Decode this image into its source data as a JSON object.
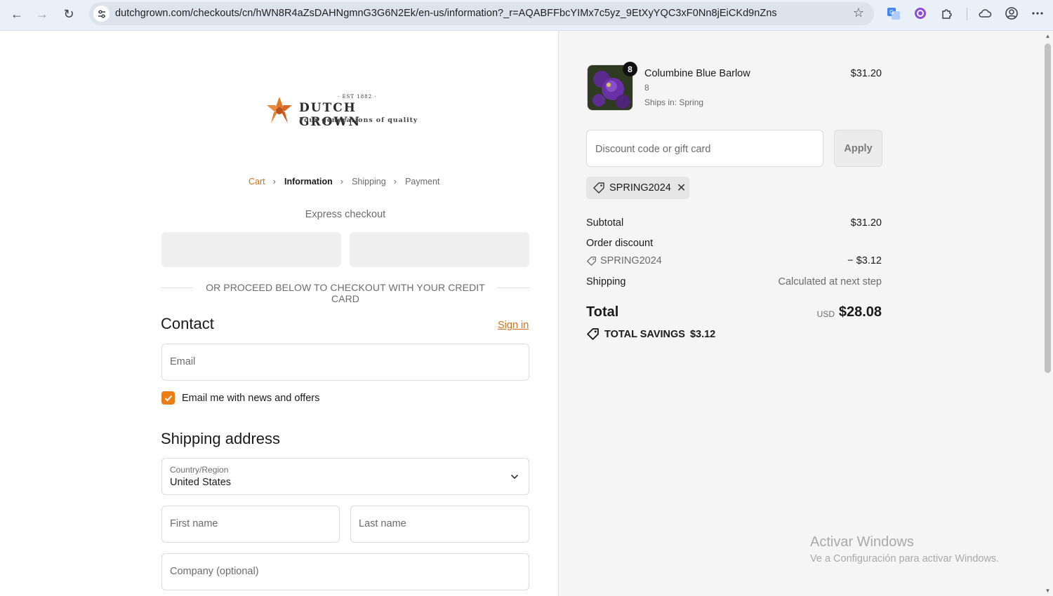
{
  "browser": {
    "url": "dutchgrown.com/checkouts/cn/hWN8R4aZsDAHNgmnG3G6N2Ek/en-us/information?_r=AQABFFbcYIMx7c5yz_9EtXyYQC3xF0Nn8jEiCKd9nZns"
  },
  "logo": {
    "est": "· EST 1882 ·",
    "brand": "DUTCH GROWN",
    "tagline": "Four generations of quality"
  },
  "breadcrumb": {
    "cart": "Cart",
    "information": "Information",
    "shipping": "Shipping",
    "payment": "Payment"
  },
  "express": {
    "label": "Express checkout",
    "divider_text": "OR PROCEED BELOW TO CHECKOUT WITH YOUR CREDIT CARD"
  },
  "contact": {
    "heading": "Contact",
    "sign_in": "Sign in",
    "email_placeholder": "Email",
    "newsletter_label": "Email me with news and offers",
    "newsletter_checked": true
  },
  "shipping_address": {
    "heading": "Shipping address",
    "country_label": "Country/Region",
    "country_value": "United States",
    "first_name_placeholder": "First name",
    "last_name_placeholder": "Last name",
    "company_placeholder": "Company (optional)"
  },
  "order": {
    "item": {
      "name": "Columbine Blue Barlow",
      "quantity_badge": "8",
      "variant": "8",
      "ships": "Ships in: Spring",
      "price": "$31.20"
    },
    "discount_placeholder": "Discount code or gift card",
    "apply_label": "Apply",
    "applied_code": "SPRING2024",
    "subtotal_label": "Subtotal",
    "subtotal_value": "$31.20",
    "order_discount_label": "Order discount",
    "discount_code": "SPRING2024",
    "discount_value": "− $3.12",
    "shipping_label": "Shipping",
    "shipping_value": "Calculated at next step",
    "total_label": "Total",
    "currency": "USD",
    "total_value": "$28.08",
    "savings_label": "TOTAL SAVINGS",
    "savings_value": "$3.12"
  },
  "watermark": {
    "line1": "Activar Windows",
    "line2": "Ve a Configuración para activar Windows."
  },
  "colors": {
    "accent": "#e97e16",
    "link": "#d1711a",
    "sidebar_bg": "#f5f5f5"
  }
}
